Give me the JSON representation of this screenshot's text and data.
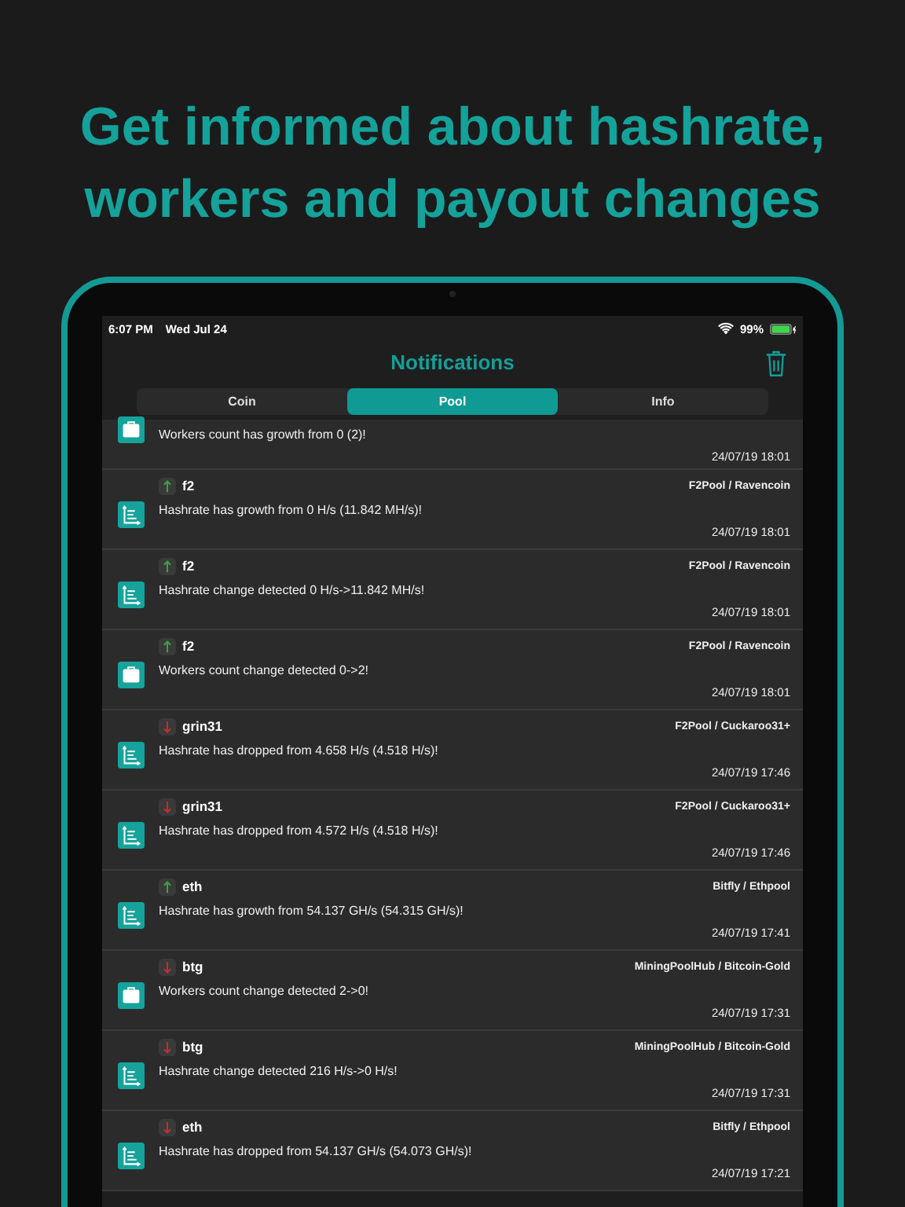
{
  "headline": "Get informed about hashrate, workers and payout changes",
  "status_bar": {
    "time": "6:07 PM",
    "date": "Wed Jul 24",
    "battery": "99%"
  },
  "nav": {
    "title": "Notifications"
  },
  "tabs": [
    {
      "label": "Coin",
      "selected": false
    },
    {
      "label": "Pool",
      "selected": true
    },
    {
      "label": "Info",
      "selected": false
    }
  ],
  "notifications": [
    {
      "kind": "workers",
      "message": "Workers count has growth from 0 (2)!",
      "time": "24/07/19 18:01"
    },
    {
      "kind": "hashrate",
      "rising": true,
      "name": "f2",
      "pool": "F2Pool / Ravencoin",
      "message": "Hashrate has growth from 0 H/s (11.842 MH/s)!",
      "time": "24/07/19 18:01"
    },
    {
      "kind": "hashrate",
      "rising": true,
      "name": "f2",
      "pool": "F2Pool / Ravencoin",
      "message": "Hashrate change detected 0 H/s->11.842 MH/s!",
      "time": "24/07/19 18:01"
    },
    {
      "kind": "workers",
      "rising": true,
      "name": "f2",
      "pool": "F2Pool / Ravencoin",
      "message": "Workers count change detected 0->2!",
      "time": "24/07/19 18:01"
    },
    {
      "kind": "hashrate",
      "rising": false,
      "name": "grin31",
      "pool": "F2Pool / Cuckaroo31+",
      "message": "Hashrate has dropped from 4.658 H/s (4.518 H/s)!",
      "time": "24/07/19 17:46"
    },
    {
      "kind": "hashrate",
      "rising": false,
      "name": "grin31",
      "pool": "F2Pool / Cuckaroo31+",
      "message": "Hashrate has dropped from 4.572 H/s (4.518 H/s)!",
      "time": "24/07/19 17:46"
    },
    {
      "kind": "hashrate",
      "rising": true,
      "name": "eth",
      "pool": "Bitfly / Ethpool",
      "message": "Hashrate has growth from 54.137 GH/s (54.315 GH/s)!",
      "time": "24/07/19 17:41"
    },
    {
      "kind": "workers",
      "rising": false,
      "name": "btg",
      "pool": "MiningPoolHub / Bitcoin-Gold",
      "message": "Workers count change detected 2->0!",
      "time": "24/07/19 17:31"
    },
    {
      "kind": "hashrate",
      "rising": false,
      "name": "btg",
      "pool": "MiningPoolHub / Bitcoin-Gold",
      "message": "Hashrate change detected 216 H/s->0 H/s!",
      "time": "24/07/19 17:31"
    },
    {
      "kind": "hashrate",
      "rising": false,
      "name": "eth",
      "pool": "Bitfly / Ethpool",
      "message": "Hashrate has dropped from 54.137 GH/s (54.073 GH/s)!",
      "time": "24/07/19 17:21"
    }
  ]
}
